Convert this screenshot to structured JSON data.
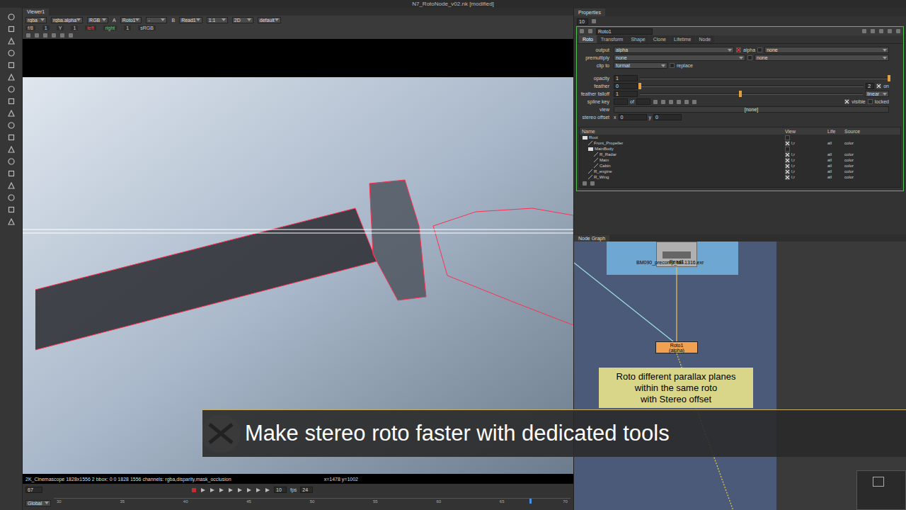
{
  "window": {
    "title": "N7_RotoNode_v02.nk [modified]"
  },
  "viewer": {
    "tab": "Viewer1",
    "controls_row1": [
      {
        "label": "rgba",
        "kind": "dropdown"
      },
      {
        "label": "rgba.alpha",
        "kind": "dropdown"
      },
      {
        "label": "RGB",
        "kind": "dropdown"
      },
      {
        "label": "A",
        "kind": "text"
      },
      {
        "label": "Roto1",
        "kind": "dropdown"
      },
      {
        "label": "-",
        "kind": "dropdown"
      },
      {
        "label": "B",
        "kind": "text"
      },
      {
        "label": "Read1",
        "kind": "dropdown"
      },
      {
        "label": "1:1",
        "kind": "dropdown"
      },
      {
        "label": "2D",
        "kind": "dropdown"
      },
      {
        "label": "default",
        "kind": "dropdown"
      }
    ],
    "controls_row2": [
      {
        "label": "f/8",
        "color": "#cccccc"
      },
      {
        "label": "1",
        "color": "#cccccc"
      },
      {
        "label": "Y",
        "color": "#cccccc"
      },
      {
        "label": "1",
        "color": "#cccccc"
      },
      {
        "label": "left",
        "color": "#ff4040"
      },
      {
        "label": "right",
        "color": "#40e060"
      },
      {
        "label": "1",
        "color": "#cccccc"
      },
      {
        "label": "sRGB",
        "color": "#cccccc"
      }
    ],
    "info": "2K_Cinemascope 1828x1556 2 bbox: 0 0 1828 1556 channels: rgba,disparity,mask_occlusion",
    "coords": "x=1478 y=1002"
  },
  "timeline": {
    "frame": "67",
    "scope": "Global",
    "step": "10",
    "fps_label": "fps",
    "fps": "24",
    "ticks": [
      "30",
      "35",
      "40",
      "45",
      "50",
      "55",
      "60",
      "65",
      "70"
    ],
    "playhead": 0.92
  },
  "properties": {
    "title": "Properties",
    "count": "10",
    "node": "Roto1",
    "tabs": [
      {
        "label": "Roto",
        "selected": true
      },
      {
        "label": "Transform",
        "selected": false
      },
      {
        "label": "Shape",
        "selected": false
      },
      {
        "label": "Clone",
        "selected": false
      },
      {
        "label": "Lifetime",
        "selected": false
      },
      {
        "label": "Node",
        "selected": false
      }
    ],
    "output": {
      "label": "output",
      "value": "alpha",
      "channel": "alpha",
      "channel_checked": true,
      "extra_checked": false,
      "extra": "none"
    },
    "premultiply": {
      "label": "premultiply",
      "value": "none",
      "extra_checked": false,
      "extra": "none"
    },
    "clip": {
      "label": "clip to",
      "value": "format",
      "replace_label": "replace",
      "replace_checked": false
    },
    "opacity": {
      "label": "opacity",
      "value": "1",
      "level": 1
    },
    "feather": {
      "label": "feather",
      "value": "0",
      "level": 0,
      "count": "2",
      "on_label": "on",
      "on_checked": true
    },
    "falloff": {
      "label": "feather falloff",
      "value": "1",
      "level": 0.45,
      "mode": "linear"
    },
    "spline": {
      "label": "spline key",
      "of": "of",
      "visible_label": "visible",
      "visible_checked": true,
      "locked_label": "locked",
      "locked_checked": false
    },
    "view": {
      "label": "view",
      "value": "[none]"
    },
    "stereo": {
      "label": "stereo offset",
      "x_label": "x",
      "x": "0",
      "y_label": "y",
      "y": "0"
    },
    "columns": [
      "Name",
      "View",
      "Life",
      "Source"
    ],
    "layers": [
      {
        "name": "Root",
        "depth": 0,
        "kind": "folder",
        "view": "",
        "life": "",
        "source": ""
      },
      {
        "name": "Front_Propeller",
        "depth": 1,
        "kind": "shape",
        "view": "l,r",
        "life": "all",
        "source": "color"
      },
      {
        "name": "MainBody",
        "depth": 1,
        "kind": "folder",
        "view": "",
        "life": "",
        "source": ""
      },
      {
        "name": "R_Radar",
        "depth": 2,
        "kind": "shape",
        "view": "l,r",
        "life": "all",
        "source": "color"
      },
      {
        "name": "Main",
        "depth": 2,
        "kind": "shape",
        "view": "l,r",
        "life": "all",
        "source": "color"
      },
      {
        "name": "Cabin",
        "depth": 2,
        "kind": "shape",
        "view": "l,r",
        "life": "all",
        "source": "color"
      },
      {
        "name": "R_engine",
        "depth": 1,
        "kind": "shape",
        "view": "l,r",
        "life": "all",
        "source": "color"
      },
      {
        "name": "R_Wing",
        "depth": 1,
        "kind": "shape",
        "view": "l,r",
        "life": "all",
        "source": "color"
      }
    ]
  },
  "node_graph": {
    "title": "Node Graph",
    "read": {
      "name": "Read1",
      "file": "BM090_precomp_tail.1316.exr"
    },
    "roto": {
      "name": "Roto1",
      "channel": "(alpha)"
    },
    "note": [
      "Roto different parallax planes",
      "within the same roto",
      "with Stereo offset"
    ]
  },
  "banner": "Make stereo roto faster with dedicated tools"
}
